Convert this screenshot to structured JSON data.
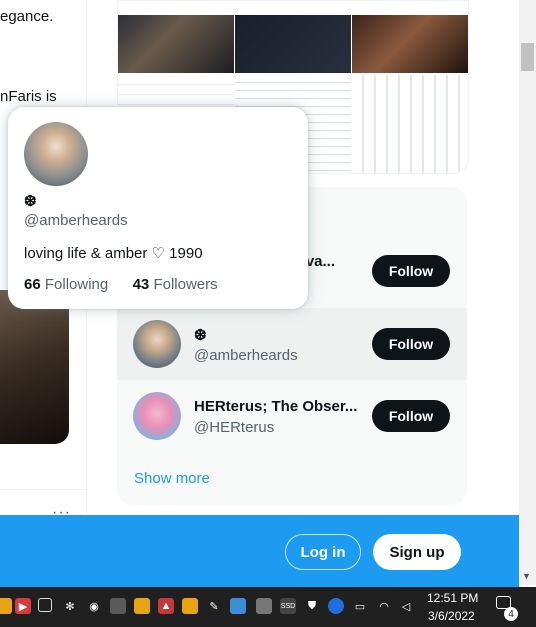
{
  "feed": {
    "line1": "egance.",
    "line2": "nFaris is",
    "more_label": "···"
  },
  "who_to_follow": {
    "rows": [
      {
        "name": "...otiva...",
        "handle": "",
        "follow_label": "Follow"
      },
      {
        "name": "❆",
        "handle": "@amberheards",
        "follow_label": "Follow"
      },
      {
        "name": "HERterus; The Obser...",
        "handle": "@HERterus",
        "follow_label": "Follow"
      }
    ],
    "show_more": "Show more"
  },
  "hover_card": {
    "name": "❆",
    "handle": "@amberheards",
    "bio": "loving life & amber ♡ 1990",
    "following_count": "66",
    "following_label": "Following",
    "followers_count": "43",
    "followers_label": "Followers"
  },
  "bottom_bar": {
    "login_label": "Log in",
    "signup_label": "Sign up"
  },
  "taskbar": {
    "time": "12:51 PM",
    "date": "3/6/2022",
    "notification_count": "4",
    "icons": [
      "folder-icon",
      "record-icon",
      "camera-icon",
      "grid-icon",
      "obs-icon",
      "app-icon",
      "java-icon",
      "vlc-icon",
      "pen-icon",
      "photo-icon",
      "monitor-icon",
      "ssd-icon",
      "shield-icon",
      "bluetooth-icon",
      "battery-icon",
      "wifi-icon",
      "volume-icon"
    ]
  },
  "colors": {
    "brand_blue": "#1d9bf0",
    "text_primary": "#0f1419",
    "text_secondary": "#536471",
    "follow_button": "#0f1419",
    "taskbar": "#202020"
  }
}
